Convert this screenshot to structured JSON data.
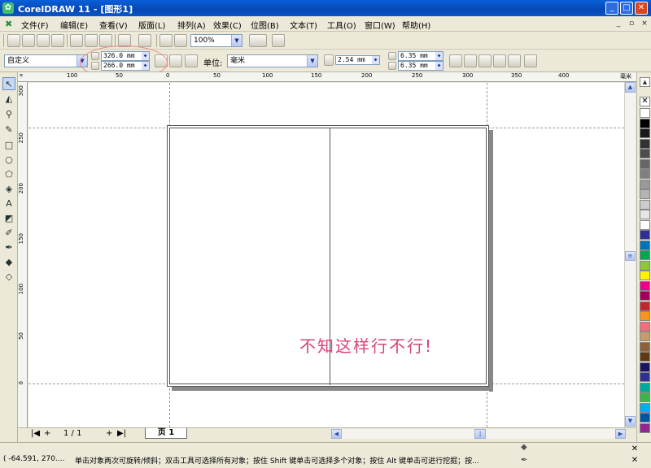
{
  "window": {
    "title": "CorelDRAW 11 - [图形1]",
    "app_icon": "coreldraw-icon",
    "minimize": "_",
    "maximize": "□",
    "close": "✕"
  },
  "menubar": {
    "items": [
      "文件(F)",
      "编辑(E)",
      "查看(V)",
      "版面(L)",
      "排列(A)",
      "效果(C)",
      "位图(B)",
      "文本(T)",
      "工具(O)",
      "窗口(W)",
      "帮助(H)"
    ],
    "doc_minimize": "_",
    "doc_restore": "▫",
    "doc_close": "×"
  },
  "toolbar": {
    "zoom": "100%"
  },
  "propbar": {
    "paper_size": "自定义",
    "width": "326.0 mm",
    "height": "266.0 mm",
    "units_label": "单位:",
    "units": "毫米",
    "nudge": "2.54 mm",
    "dup_x": "6.35 mm",
    "dup_y": "6.35 mm"
  },
  "ruler": {
    "unit": "毫米",
    "corner": "⌗",
    "h_ticks": [
      "100",
      "50",
      "0",
      "50",
      "100",
      "150",
      "200",
      "250",
      "300",
      "350",
      "400"
    ],
    "v_ticks": [
      "300",
      "250",
      "200",
      "150",
      "100",
      "50",
      "0"
    ]
  },
  "canvas": {
    "annotation": "不知这样行不行!"
  },
  "page_nav": {
    "first": "|◀",
    "prev": "◀",
    "counter": "1 / 1",
    "next": "▶",
    "last": "▶|",
    "tab": "页 1",
    "add_before": "+",
    "add_after": "+"
  },
  "palette": {
    "no_color": "✕",
    "colors": [
      "#ffffff",
      "#000000",
      "#1a1a1a",
      "#333333",
      "#4d4d4d",
      "#666666",
      "#808080",
      "#999999",
      "#b3b3b3",
      "#cccccc",
      "#e6e6e6",
      "#ffffff",
      "#2e3192",
      "#0072bc",
      "#00a651",
      "#8dc63f",
      "#fff200",
      "#ec008c",
      "#9e005d",
      "#c1272d",
      "#f7941d",
      "#f26d7d",
      "#c69c6d",
      "#8c6239",
      "#603913",
      "#1b1464",
      "#2e3192",
      "#00a99d",
      "#39b54a",
      "#00aeef",
      "#0054a6",
      "#92278f"
    ]
  },
  "status": {
    "coords": "( -64.591, 270....",
    "hint": "单击对象两次可旋转/倾斜；双击工具可选择所有对象；按住 Shift 键单击可选择多个对象；按住 Alt 键单击可进行挖掘；按...",
    "no_fill": "✕",
    "no_outline": "✕"
  }
}
